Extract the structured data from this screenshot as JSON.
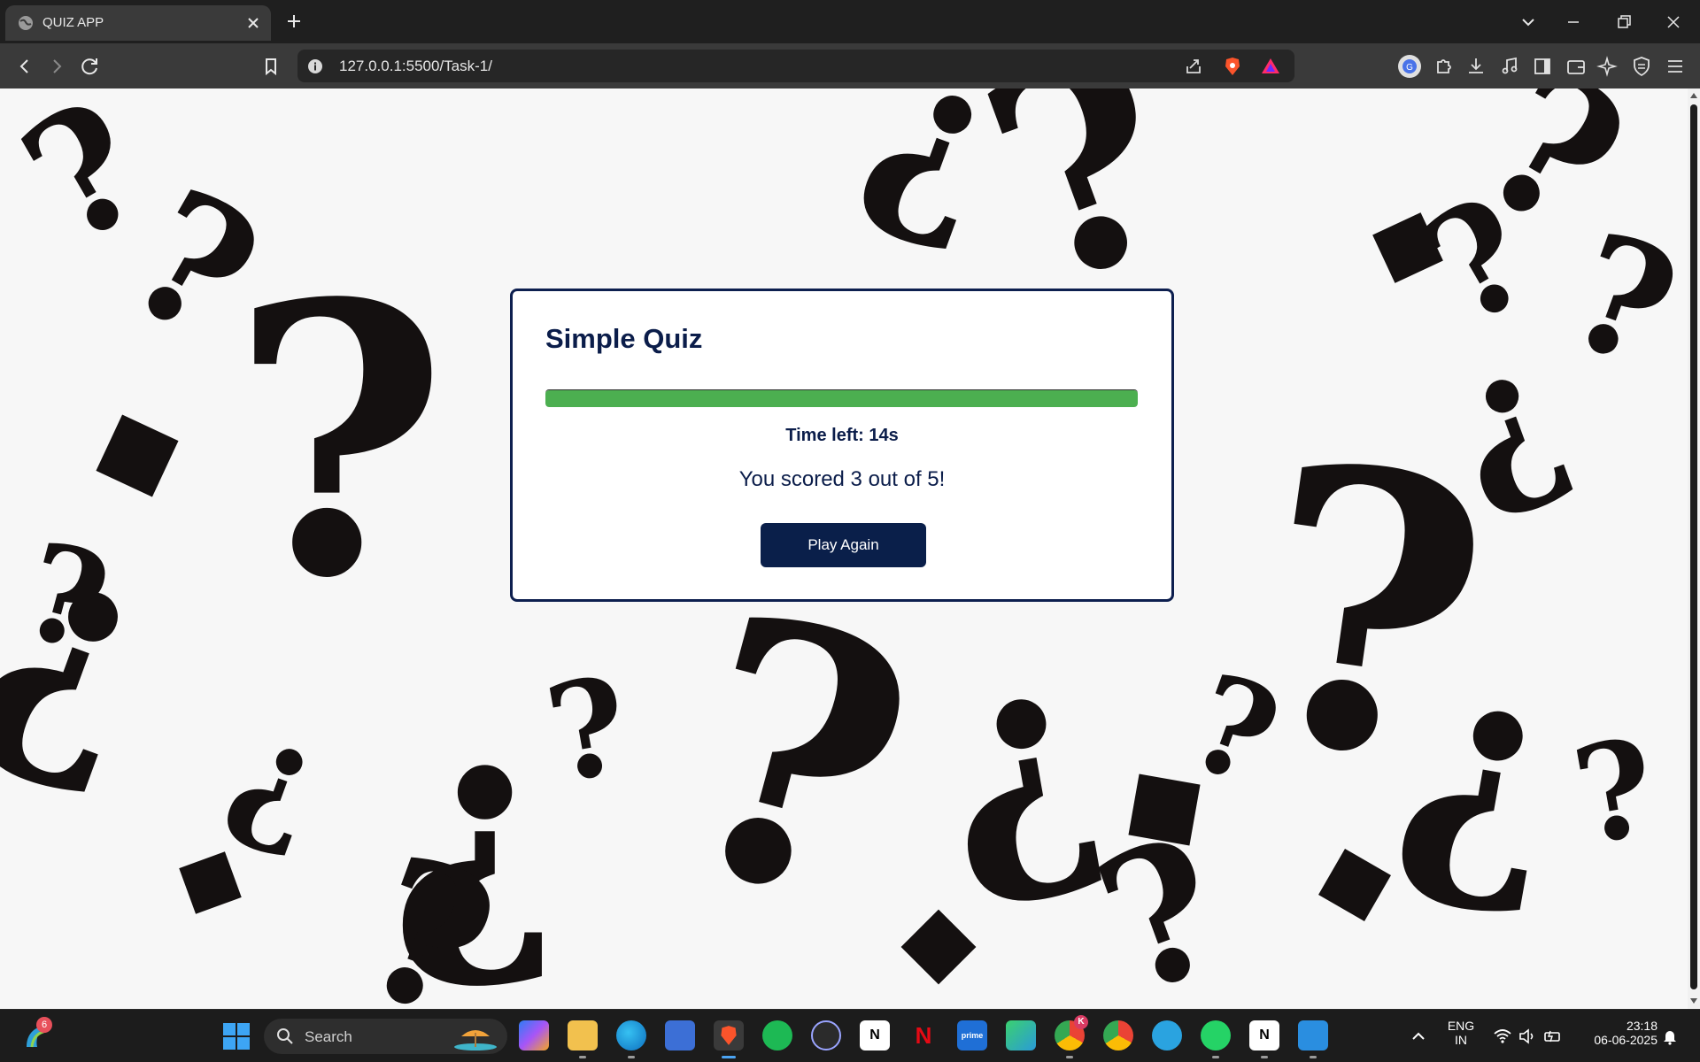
{
  "browser": {
    "tab_title": "QUIZ APP",
    "url": "127.0.0.1:5500/Task-1/"
  },
  "quiz": {
    "title": "Simple Quiz",
    "progress": 1.0,
    "timer_text": "Time left: 14s",
    "score_text": "You scored 3 out of 5!",
    "play_again_label": "Play Again"
  },
  "taskbar": {
    "widget_badge": "6",
    "search_label": "Search",
    "chrome_badge": "K",
    "language_line1": "ENG",
    "language_line2": "IN",
    "time": "23:18",
    "date": "06-06-2025"
  },
  "colors": {
    "card_border": "#0d1f4f",
    "title_text": "#0b1d4a",
    "progress_fill": "#4caf50",
    "button_bg": "#0a1f4a"
  }
}
